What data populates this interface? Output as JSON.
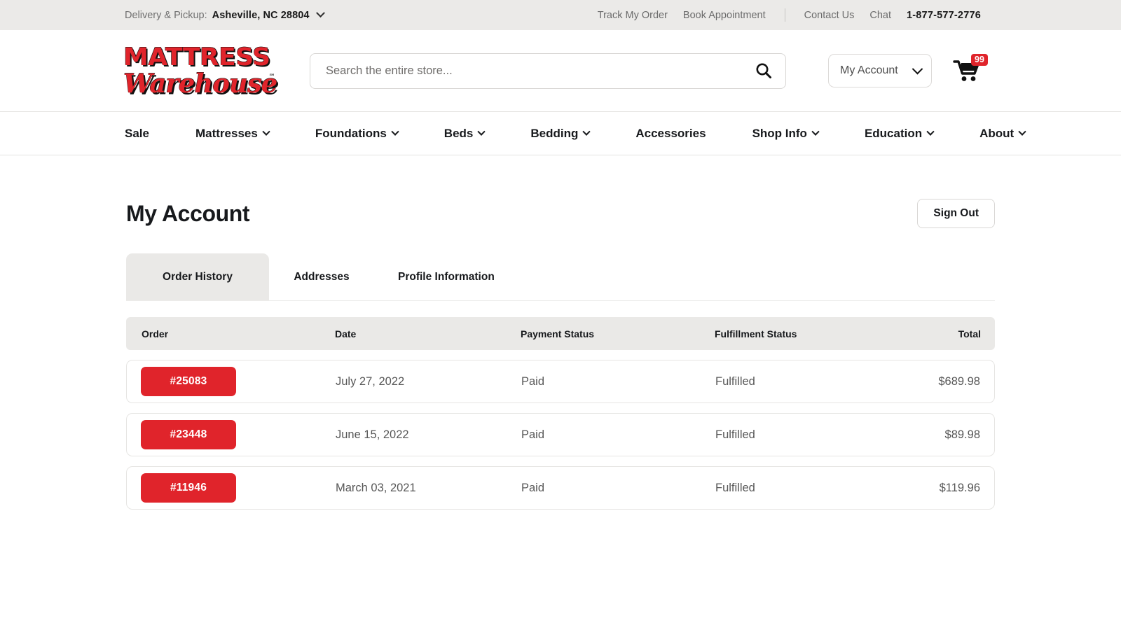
{
  "utility_bar": {
    "delivery_label": "Delivery & Pickup:",
    "location": "Asheville, NC 28804",
    "links": [
      "Track My Order",
      "Book Appointment",
      "Contact Us",
      "Chat"
    ],
    "phone": "1-877-577-2776"
  },
  "header": {
    "logo_line1": "MATTRESS",
    "logo_line2": "Warehouse",
    "logo_tm": "℠",
    "search_placeholder": "Search the entire store...",
    "search_value": "",
    "account_label": "My Account",
    "cart_count": "99"
  },
  "nav": {
    "items": [
      {
        "label": "Sale",
        "has_dropdown": false
      },
      {
        "label": "Mattresses",
        "has_dropdown": true
      },
      {
        "label": "Foundations",
        "has_dropdown": true
      },
      {
        "label": "Beds",
        "has_dropdown": true
      },
      {
        "label": "Bedding",
        "has_dropdown": true
      },
      {
        "label": "Accessories",
        "has_dropdown": false
      },
      {
        "label": "Shop Info",
        "has_dropdown": true
      },
      {
        "label": "Education",
        "has_dropdown": true
      },
      {
        "label": "About",
        "has_dropdown": true
      }
    ]
  },
  "page": {
    "title": "My Account",
    "sign_out_label": "Sign Out",
    "tabs": [
      {
        "label": "Order History",
        "active": true
      },
      {
        "label": "Addresses",
        "active": false
      },
      {
        "label": "Profile Information",
        "active": false
      }
    ]
  },
  "orders_table": {
    "columns": [
      "Order",
      "Date",
      "Payment Status",
      "Fulfillment Status",
      "Total"
    ],
    "rows": [
      {
        "order": "#25083",
        "date": "July 27, 2022",
        "payment_status": "Paid",
        "fulfillment_status": "Fulfilled",
        "total": "$689.98"
      },
      {
        "order": "#23448",
        "date": "June 15, 2022",
        "payment_status": "Paid",
        "fulfillment_status": "Fulfilled",
        "total": "$89.98"
      },
      {
        "order": "#11946",
        "date": "March 03, 2021",
        "payment_status": "Paid",
        "fulfillment_status": "Fulfilled",
        "total": "$119.96"
      }
    ]
  },
  "colors": {
    "brand_red": "#e0242b",
    "bar_gray": "#ebeae8",
    "panel_gray": "#eae9e7",
    "text_dark": "#17191c",
    "text_muted": "#6b6b6b"
  }
}
